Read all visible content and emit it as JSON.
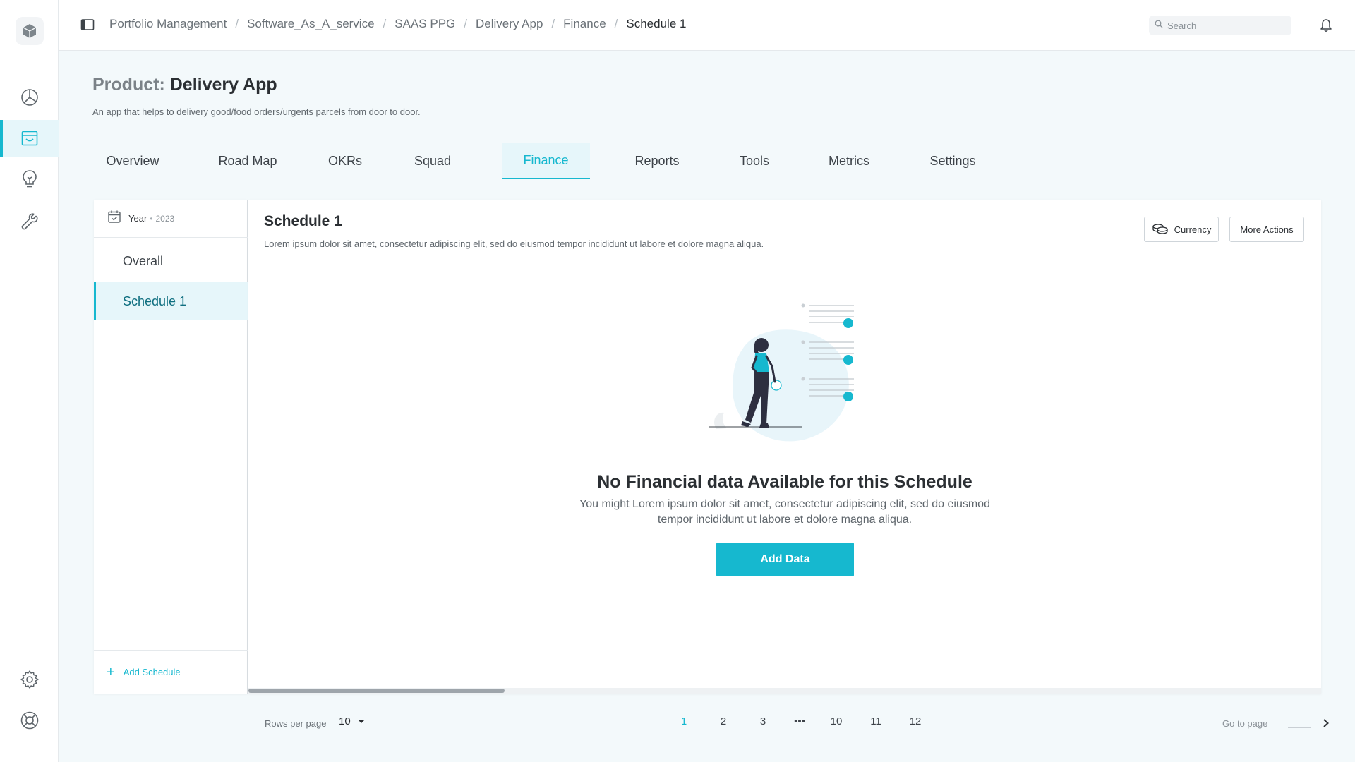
{
  "app": {
    "logo_icon": "cube-icon",
    "nav": [
      {
        "name": "dashboard",
        "icon": "pie-chart-icon",
        "active": false
      },
      {
        "name": "products",
        "icon": "inbox-icon",
        "active": true
      },
      {
        "name": "ideas",
        "icon": "lightbulb-icon",
        "active": false
      },
      {
        "name": "tools",
        "icon": "wrench-icon",
        "active": false
      }
    ],
    "bottom_nav": [
      {
        "name": "settings",
        "icon": "gear-icon"
      },
      {
        "name": "help",
        "icon": "lifebuoy-icon"
      }
    ]
  },
  "topbar": {
    "breadcrumb": [
      "Portfolio Management",
      "Software_As_A_service",
      "SAAS PPG",
      "Delivery App",
      "Finance",
      "Schedule 1"
    ],
    "separator": "/",
    "search_placeholder": "Search"
  },
  "product": {
    "prefix": "Product:",
    "name": "Delivery App",
    "description": "An app that helps to delivery good/food orders/urgents parcels from door to door."
  },
  "tabs": [
    {
      "label": "Overview",
      "active": false
    },
    {
      "label": "Road Map",
      "active": false
    },
    {
      "label": "OKRs",
      "active": false
    },
    {
      "label": "Squad",
      "active": false
    },
    {
      "label": "Finance",
      "active": true
    },
    {
      "label": "Reports",
      "active": false
    },
    {
      "label": "Tools",
      "active": false
    },
    {
      "label": "Metrics",
      "active": false
    },
    {
      "label": "Settings",
      "active": false
    }
  ],
  "schedules": {
    "year_label": "Year",
    "year_dot": "•",
    "year_value": "2023",
    "items": [
      {
        "label": "Overall",
        "active": false
      },
      {
        "label": "Schedule 1",
        "active": true
      }
    ],
    "add_label": "Add Schedule"
  },
  "schedule": {
    "title": "Schedule 1",
    "description": "Lorem ipsum dolor sit amet, consectetur adipiscing elit, sed do eiusmod tempor incididunt ut labore et dolore magna aliqua.",
    "currency_label": "Currency",
    "more_actions_label": "More Actions",
    "empty": {
      "title": "No Financial data Available for this Schedule",
      "description": "You might Lorem ipsum dolor sit amet, consectetur adipiscing elit, sed do eiusmod tempor incididunt ut labore et dolore magna aliqua.",
      "button": "Add Data"
    }
  },
  "pagination": {
    "rows_label": "Rows per page",
    "rows_value": "10",
    "pages": [
      "1",
      "2",
      "3",
      "•••",
      "10",
      "11",
      "12"
    ],
    "active_page": "1",
    "goto_label": "Go to page"
  },
  "colors": {
    "accent": "#16b8cf",
    "accent_light": "#e6f6fa",
    "text": "#2b2f33",
    "muted": "#6b7278"
  }
}
